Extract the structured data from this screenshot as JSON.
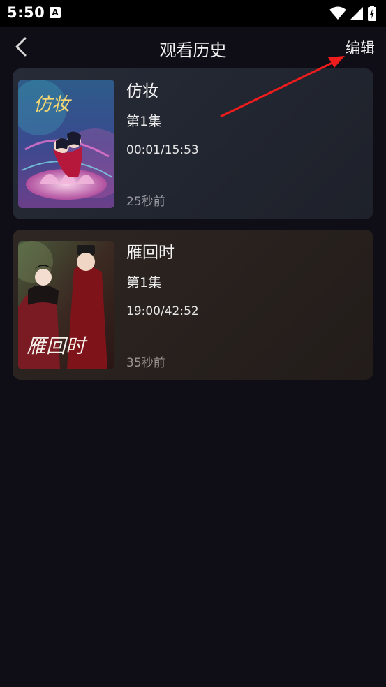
{
  "status_bar": {
    "time": "5:50",
    "notification_icon_letter": "A"
  },
  "header": {
    "title": "观看历史",
    "edit_label": "编辑"
  },
  "history": [
    {
      "title": "仿妆",
      "episode": "第1集",
      "progress": "00:01/15:53",
      "watched_ago": "25秒前",
      "poster_text": "仿妆"
    },
    {
      "title": "雁回时",
      "episode": "第1集",
      "progress": "19:00/42:52",
      "watched_ago": "35秒前",
      "poster_text": "雁回时"
    }
  ],
  "colors": {
    "background": "#0f0e16",
    "annotation_arrow": "#ee1c1c"
  }
}
